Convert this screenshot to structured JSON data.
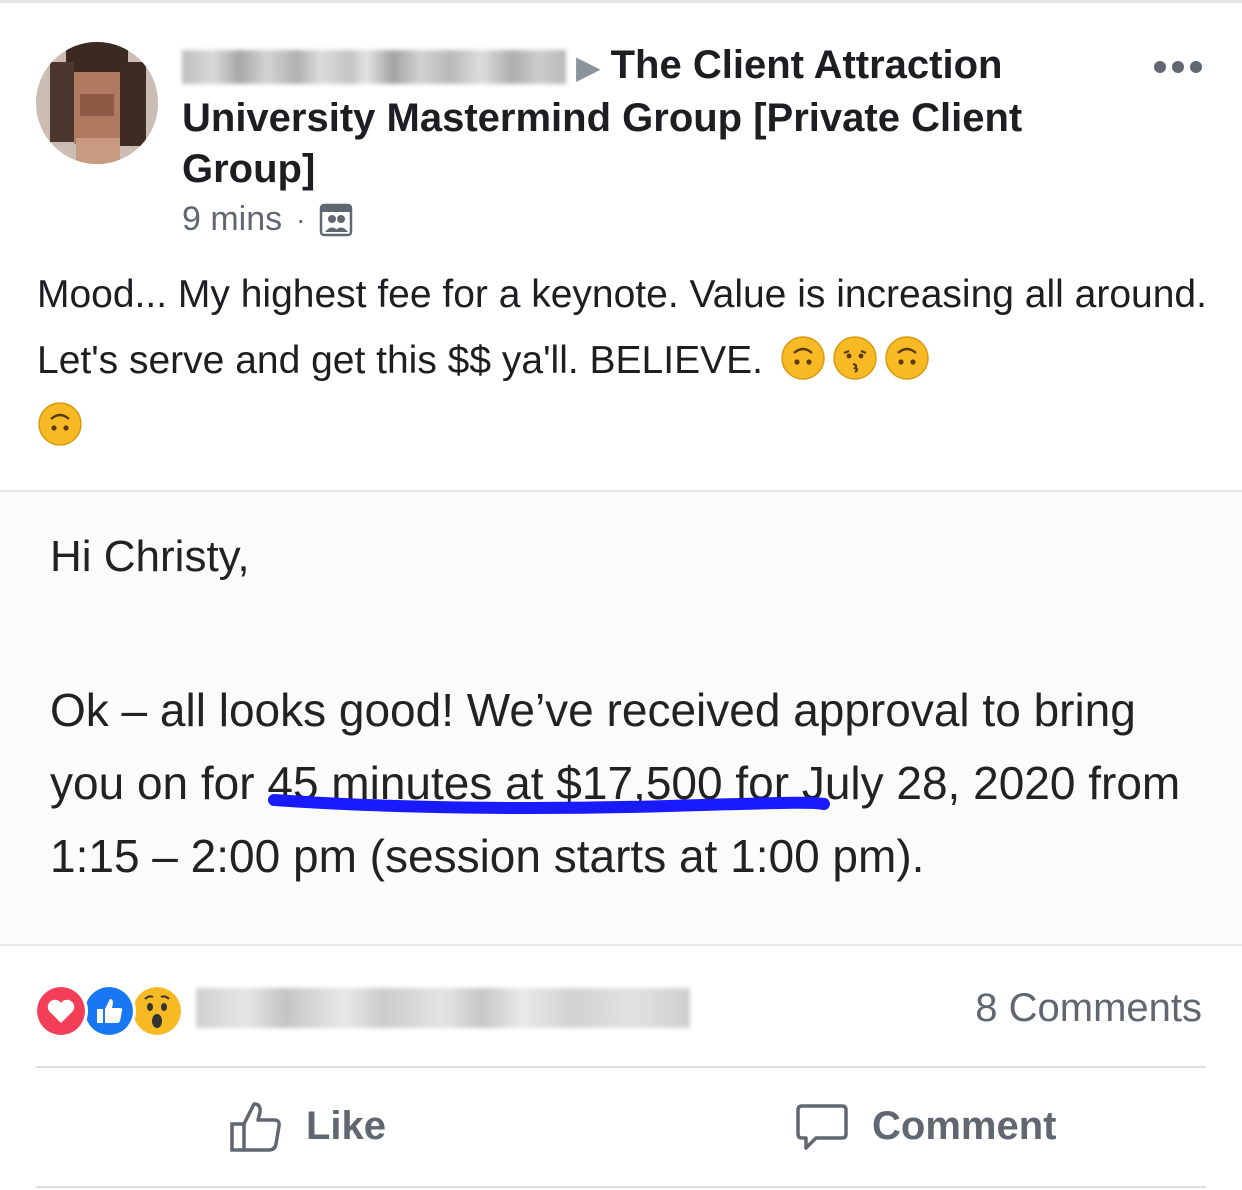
{
  "post": {
    "group_name": "The Client Attraction University Mastermind Group [Private Client Group]",
    "timestamp": "9 mins",
    "separator": "·",
    "audience_icon": "group-audience-icon",
    "text": "Mood... My highest fee for a keynote. Value is increasing all around. Let's serve and get this $$ ya'll. BELIEVE.",
    "emojis": [
      "upside-down-face",
      "kissing-face",
      "upside-down-face",
      "upside-down-face"
    ]
  },
  "attachment": {
    "greeting": "Hi Christy,",
    "body": "Ok – all looks good! We’ve received approval to bring you on for 45 minutes at $17,500 for July 28, 2020 from 1:15 – 2:00 pm (session starts at 1:00 pm)."
  },
  "engagement": {
    "reactions": [
      "love",
      "like",
      "wow"
    ],
    "comments_count": "8 Comments"
  },
  "actions": {
    "like_label": "Like",
    "comment_label": "Comment"
  },
  "colors": {
    "accent_blue": "#1877f2",
    "love_red": "#f33e58",
    "underline_blue": "#1a1aff"
  }
}
